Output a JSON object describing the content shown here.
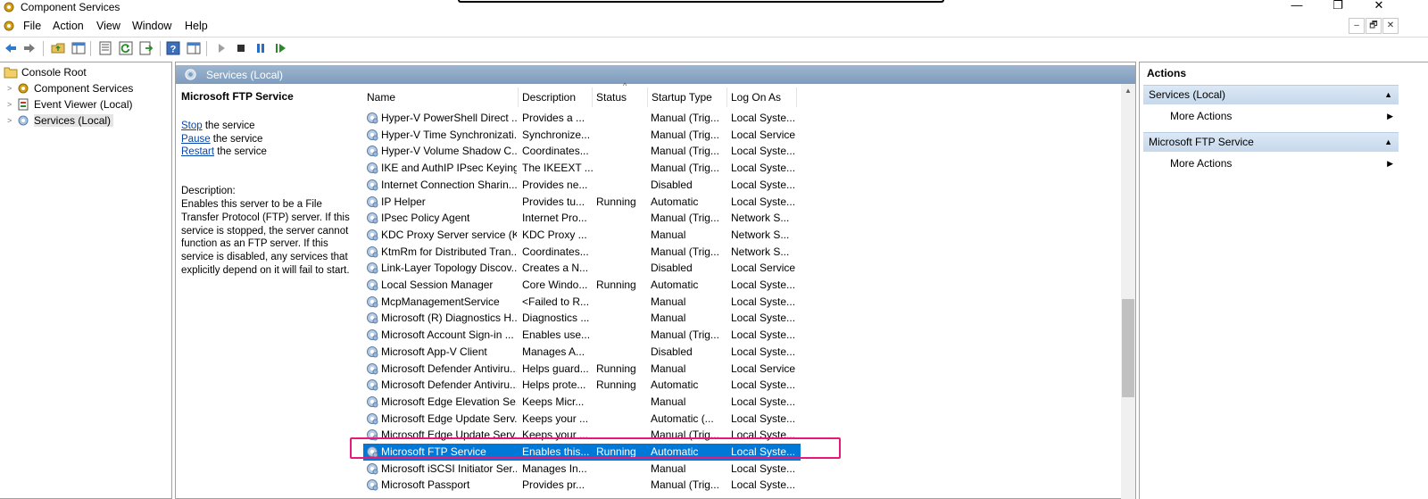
{
  "window": {
    "title": "Component Services",
    "controls": {
      "minimize": "—",
      "restore": "❐",
      "close": "✕"
    }
  },
  "menu": {
    "items": [
      "File",
      "Action",
      "View",
      "Window",
      "Help"
    ],
    "mdi_controls": [
      "–",
      "🗗",
      "✕"
    ]
  },
  "toolbar": {
    "buttons": [
      {
        "name": "back-icon"
      },
      {
        "name": "forward-icon"
      },
      {
        "name": "up-folder-icon"
      },
      {
        "name": "show-hide-tree-icon"
      },
      {
        "name": "properties-icon"
      },
      {
        "name": "refresh-icon"
      },
      {
        "name": "export-list-icon"
      },
      {
        "name": "help-icon"
      },
      {
        "name": "show-hide-action-pane-icon"
      },
      {
        "name": "play-icon"
      },
      {
        "name": "stop-icon"
      },
      {
        "name": "pause-icon"
      },
      {
        "name": "restart-icon"
      }
    ]
  },
  "tree": {
    "root": "Console Root",
    "children": [
      "Component Services",
      "Event Viewer (Local)",
      "Services (Local)"
    ]
  },
  "mid": {
    "header": "Services (Local)",
    "detail": {
      "title": "Microsoft FTP Service",
      "stop_link": "Stop",
      "stop_rest": " the service",
      "pause_link": "Pause",
      "pause_rest": " the service",
      "restart_link": "Restart",
      "restart_rest": " the service",
      "desc_label": "Description:",
      "desc_lines": [
        "Enables this server to be a File",
        "Transfer Protocol (FTP) server. If this",
        "service is stopped, the server cannot",
        "function as an FTP server. If this",
        "service is disabled, any services that",
        "explicitly depend on it will fail to start."
      ]
    },
    "columns": [
      "Name",
      "Description",
      "Status",
      "Startup Type",
      "Log On As"
    ],
    "sort_indicator": "^",
    "rows": [
      [
        "Hyper-V PowerShell Direct ...",
        "Provides a ...",
        "",
        "Manual (Trig...",
        "Local Syste..."
      ],
      [
        "Hyper-V Time Synchronizati...",
        "Synchronize...",
        "",
        "Manual (Trig...",
        "Local Service"
      ],
      [
        "Hyper-V Volume Shadow C...",
        "Coordinates...",
        "",
        "Manual (Trig...",
        "Local Syste..."
      ],
      [
        "IKE and AuthIP IPsec Keying...",
        "The IKEEXT ...",
        "",
        "Manual (Trig...",
        "Local Syste..."
      ],
      [
        "Internet Connection Sharin...",
        "Provides ne...",
        "",
        "Disabled",
        "Local Syste..."
      ],
      [
        "IP Helper",
        "Provides tu...",
        "Running",
        "Automatic",
        "Local Syste..."
      ],
      [
        "IPsec Policy Agent",
        "Internet Pro...",
        "",
        "Manual (Trig...",
        "Network S..."
      ],
      [
        "KDC Proxy Server service (K...",
        "KDC Proxy ...",
        "",
        "Manual",
        "Network S..."
      ],
      [
        "KtmRm for Distributed Tran...",
        "Coordinates...",
        "",
        "Manual (Trig...",
        "Network S..."
      ],
      [
        "Link-Layer Topology Discov...",
        "Creates a N...",
        "",
        "Disabled",
        "Local Service"
      ],
      [
        "Local Session Manager",
        "Core Windo...",
        "Running",
        "Automatic",
        "Local Syste..."
      ],
      [
        "McpManagementService",
        "<Failed to R...",
        "",
        "Manual",
        "Local Syste..."
      ],
      [
        "Microsoft (R) Diagnostics H...",
        "Diagnostics ...",
        "",
        "Manual",
        "Local Syste..."
      ],
      [
        "Microsoft Account Sign-in ...",
        "Enables use...",
        "",
        "Manual (Trig...",
        "Local Syste..."
      ],
      [
        "Microsoft App-V Client",
        "Manages A...",
        "",
        "Disabled",
        "Local Syste..."
      ],
      [
        "Microsoft Defender Antiviru...",
        "Helps guard...",
        "Running",
        "Manual",
        "Local Service"
      ],
      [
        "Microsoft Defender Antiviru...",
        "Helps prote...",
        "Running",
        "Automatic",
        "Local Syste..."
      ],
      [
        "Microsoft Edge Elevation Se...",
        "Keeps Micr...",
        "",
        "Manual",
        "Local Syste..."
      ],
      [
        "Microsoft Edge Update Serv...",
        "Keeps your ...",
        "",
        "Automatic (...",
        "Local Syste..."
      ],
      [
        "Microsoft Edge Update Serv...",
        "Keeps your ...",
        "",
        "Manual (Trig...",
        "Local Syste..."
      ],
      [
        "Microsoft FTP Service",
        "Enables this...",
        "Running",
        "Automatic",
        "Local Syste..."
      ],
      [
        "Microsoft iSCSI Initiator Ser...",
        "Manages In...",
        "",
        "Manual",
        "Local Syste..."
      ],
      [
        "Microsoft Passport",
        "Provides pr...",
        "",
        "Manual (Trig...",
        "Local Syste..."
      ]
    ],
    "selected_index": 20
  },
  "actions": {
    "title": "Actions",
    "groups": [
      {
        "label": "Services (Local)",
        "item": "More Actions"
      },
      {
        "label": "Microsoft FTP Service",
        "item": "More Actions"
      }
    ]
  },
  "colors": {
    "selection": "#0078d7",
    "highlight_box": "#e8197a",
    "header_gradient": "#8aa7c7",
    "action_group": "#d2e1f1"
  }
}
